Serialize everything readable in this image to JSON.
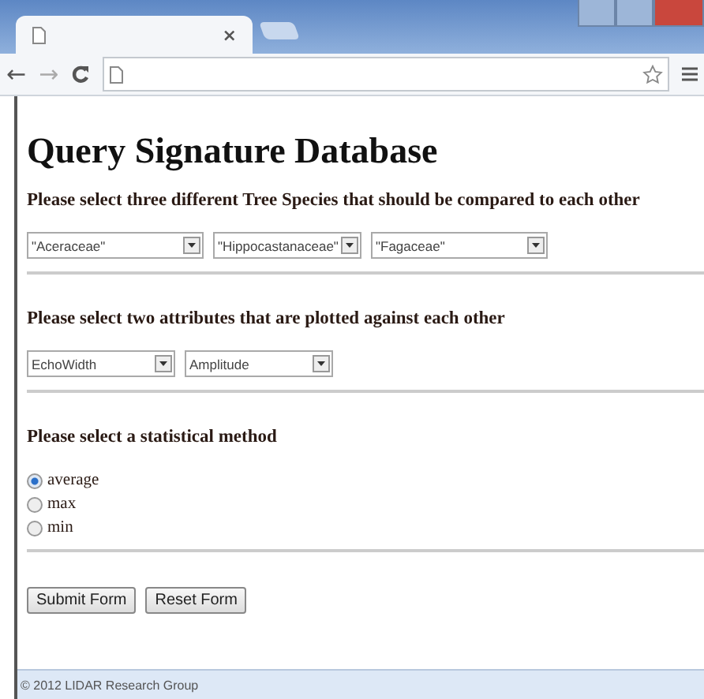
{
  "browser": {
    "tab": {
      "close": "×"
    },
    "nav": {
      "back": "←",
      "forward": "→"
    }
  },
  "page": {
    "title": "Query Signature Database",
    "sections": [
      {
        "kind": "selects",
        "heading": "Please select three different Tree Species that should be compared to each other",
        "selects": [
          {
            "value": "\"Aceraceae\"",
            "wide": true
          },
          {
            "value": "\"Hippocastanaceae\"",
            "wide": false
          },
          {
            "value": "\"Fagaceae\"",
            "wide": true
          }
        ]
      },
      {
        "kind": "selects",
        "heading": "Please select two attributes that are plotted against each other",
        "selects": [
          {
            "value": "EchoWidth",
            "wide": false
          },
          {
            "value": "Amplitude",
            "wide": false
          }
        ]
      },
      {
        "kind": "radios",
        "heading": "Please select a statistical method",
        "options": [
          {
            "label": "average",
            "selected": true
          },
          {
            "label": "max",
            "selected": false
          },
          {
            "label": "min",
            "selected": false
          }
        ]
      }
    ],
    "buttons": [
      "Submit Form",
      "Reset Form"
    ],
    "footer": "© 2012 LIDAR Research Group"
  }
}
